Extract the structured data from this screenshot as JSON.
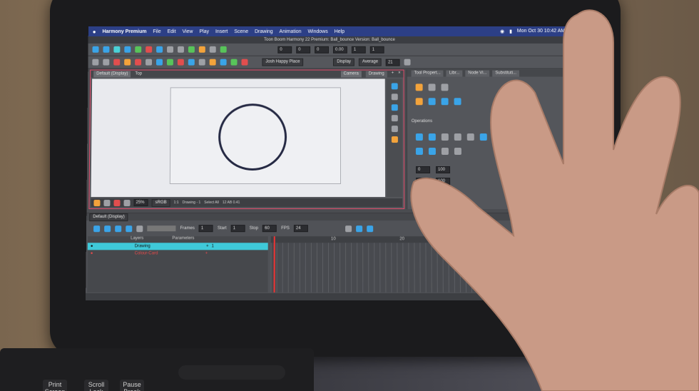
{
  "menubar": {
    "apple": "",
    "app_name": "Harmony Premium",
    "items": [
      "File",
      "Edit",
      "View",
      "Play",
      "Insert",
      "Scene",
      "Drawing",
      "Animation",
      "Windows",
      "Help"
    ],
    "clock": "Mon Oct 30  10:42 AM"
  },
  "window": {
    "title": "Toon Boom Harmony 22 Premium: Ball_bounce Version: Ball_bounce"
  },
  "toolbar": {
    "fields": [
      "0",
      "0",
      "0",
      "0.00",
      "1",
      "1"
    ],
    "preset": "Josh Happy Place",
    "display_label": "Display",
    "average_label": "Average",
    "size": "21"
  },
  "camera_panel": {
    "display_dropdown": "Default (Display)",
    "top_label": "Top",
    "tabs": [
      "Camera",
      "Drawing"
    ],
    "status": {
      "zoom": "25%",
      "colorspace": "sRGB",
      "ratio": "1:1",
      "mode": "Drawing - 1",
      "selection": "Select All",
      "fov": "12 AB 0.41"
    }
  },
  "right_panel": {
    "tabs": [
      "Tool Propert...",
      "Libr...",
      "Node Vi...",
      "Substituti..."
    ],
    "operations_label": "Operations",
    "values": [
      "0",
      "100",
      "0",
      "100"
    ]
  },
  "timeline": {
    "display_dropdown": "Default (Display)",
    "frames_label": "Frames",
    "frames": "1",
    "start_label": "Start",
    "start": "1",
    "stop_label": "Stop",
    "stop": "60",
    "fps_label": "FPS",
    "fps": "24",
    "layers_header": "Layers",
    "params_header": "Parameters",
    "layers": [
      {
        "name": "Drawing",
        "value": "1"
      },
      {
        "name": "Colour-Card",
        "value": ""
      }
    ],
    "ruler": [
      "10",
      "20"
    ]
  },
  "keyboard": {
    "keys": [
      "Print Screen",
      "Scroll Lock",
      "Pause Break"
    ]
  }
}
